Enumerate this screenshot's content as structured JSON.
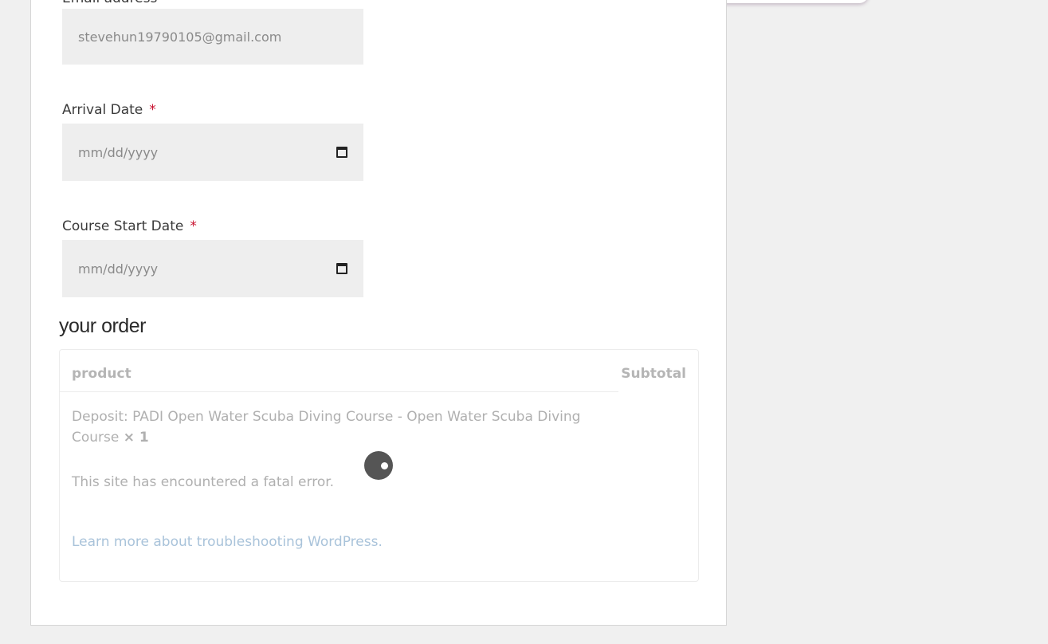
{
  "form": {
    "email_label": "Email address",
    "email_value": "stevehun19790105@gmail.com",
    "arrival_label": "Arrival Date",
    "arrival_placeholder": "mm/dd/yyyy",
    "course_start_label": "Course Start Date",
    "course_start_placeholder": "mm/dd/yyyy",
    "required_mark": "*"
  },
  "order": {
    "title": "your order",
    "col_product": "product",
    "col_subtotal": "Subtotal",
    "item_name": "Deposit: PADI Open Water Scuba Diving Course - Open Water Scuba Diving Course",
    "item_qty": "× 1",
    "error_message": "This site has encountered a fatal error.",
    "error_link": "Learn more about troubleshooting WordPress."
  },
  "icons": {
    "date_picker": "calendar-icon",
    "loading": "loading-spinner-icon"
  },
  "colors": {
    "required": "#c8102e",
    "link": "#a9c3da",
    "input_bg": "#eeeeee",
    "page_bg": "#f0f0f0"
  }
}
